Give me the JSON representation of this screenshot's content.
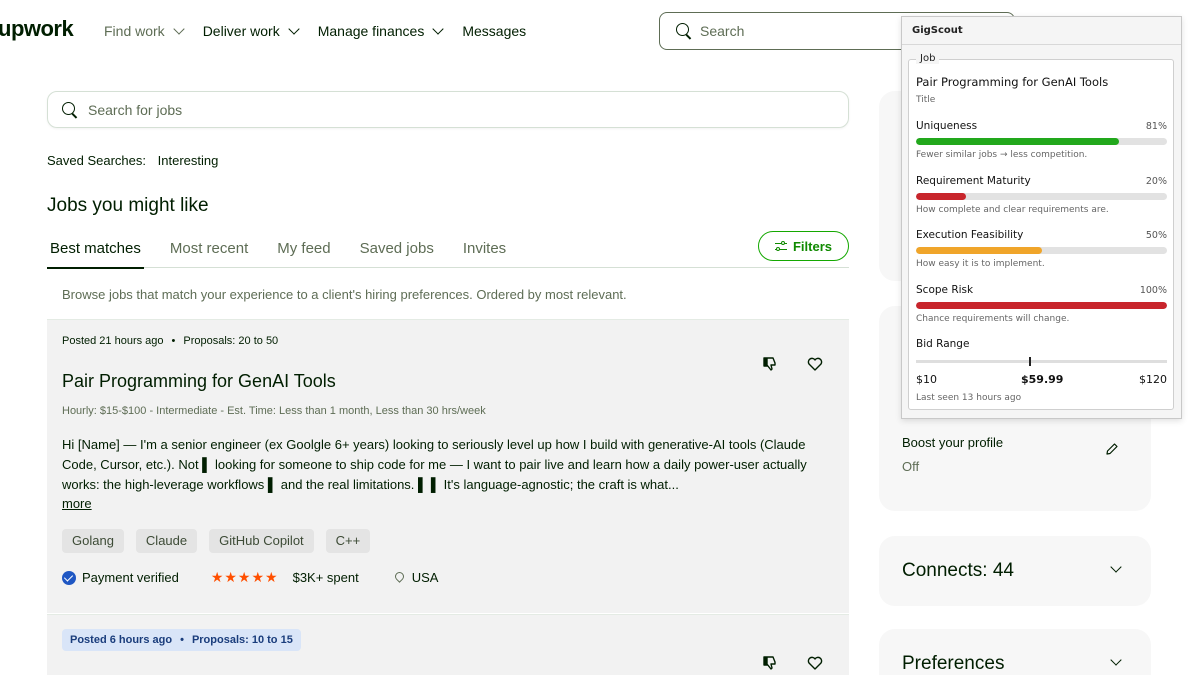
{
  "brand": {
    "logo": "upwork"
  },
  "nav": {
    "items": [
      {
        "label": "Find work",
        "has_menu": true,
        "muted": true
      },
      {
        "label": "Deliver work",
        "has_menu": true
      },
      {
        "label": "Manage finances",
        "has_menu": true
      },
      {
        "label": "Messages",
        "has_menu": false
      }
    ],
    "search_placeholder": "Search"
  },
  "main": {
    "job_search_placeholder": "Search for jobs",
    "saved_searches_label": "Saved Searches:",
    "saved_searches_value": "Interesting",
    "section_title": "Jobs you might like",
    "tabs": [
      "Best matches",
      "Most recent",
      "My feed",
      "Saved jobs",
      "Invites"
    ],
    "active_tab": "Best matches",
    "filters_label": "Filters",
    "browse_text": "Browse jobs that match your experience to a client's hiring preferences. Ordered by most relevant.",
    "jobs": [
      {
        "posted": "Posted 21 hours ago",
        "proposals": "Proposals: 20 to 50",
        "title": "Pair Programming for GenAI Tools",
        "meta_rate": "Hourly: $15-$100",
        "meta_rest": " - Intermediate - Est. Time: Less than 1 month, Less than 30 hrs/week",
        "description": "Hi [Name] — I'm a senior engineer (ex Goolgle 6+ years) looking to seriously level up how I build with generative-AI tools (Claude Code, Cursor, etc.). Not ▌ looking for someone to ship code for me — I want to pair live and learn how a daily power-user actually works: the high-leverage workflows ▌ and the real limitations. ▌ ▌ It's language-agnostic; the craft is what...",
        "more_label": "more",
        "skills": [
          "Golang",
          "Claude",
          "GitHub Copilot",
          "C++"
        ],
        "payment_verified": "Payment verified",
        "rating_stars": "★★★★★",
        "spent": "$3K+ spent",
        "location": "USA"
      },
      {
        "posted": "Posted 6 hours ago",
        "proposals": "Proposals: 10 to 15"
      }
    ]
  },
  "sidebar": {
    "boost_label": "Boost your profile",
    "boost_value": "Off",
    "connects_label": "Connects: 44",
    "preferences_label": "Preferences"
  },
  "gigscout": {
    "title": "GigScout",
    "legend": "Job",
    "job_title": "Pair Programming for GenAI Tools",
    "job_title_caption": "Title",
    "metrics": [
      {
        "label": "Uniqueness",
        "percent": "81%",
        "value": 81,
        "color": "#22a81c",
        "caption": "Fewer similar jobs → less competition."
      },
      {
        "label": "Requirement Maturity",
        "percent": "20%",
        "value": 20,
        "color": "#c8252c",
        "caption": "How complete and clear requirements are."
      },
      {
        "label": "Execution Feasibility",
        "percent": "50%",
        "value": 50,
        "color": "#f0a52a",
        "caption": "How easy it is to implement."
      },
      {
        "label": "Scope Risk",
        "percent": "100%",
        "value": 100,
        "color": "#c8252c",
        "caption": "Chance requirements will change."
      }
    ],
    "bid_range": {
      "label": "Bid Range",
      "min_label": "$10",
      "mid_label": "$59.99",
      "max_label": "$120",
      "min": 10,
      "max": 120,
      "mid": 59.99
    },
    "last_seen": "Last seen 13 hours ago"
  }
}
